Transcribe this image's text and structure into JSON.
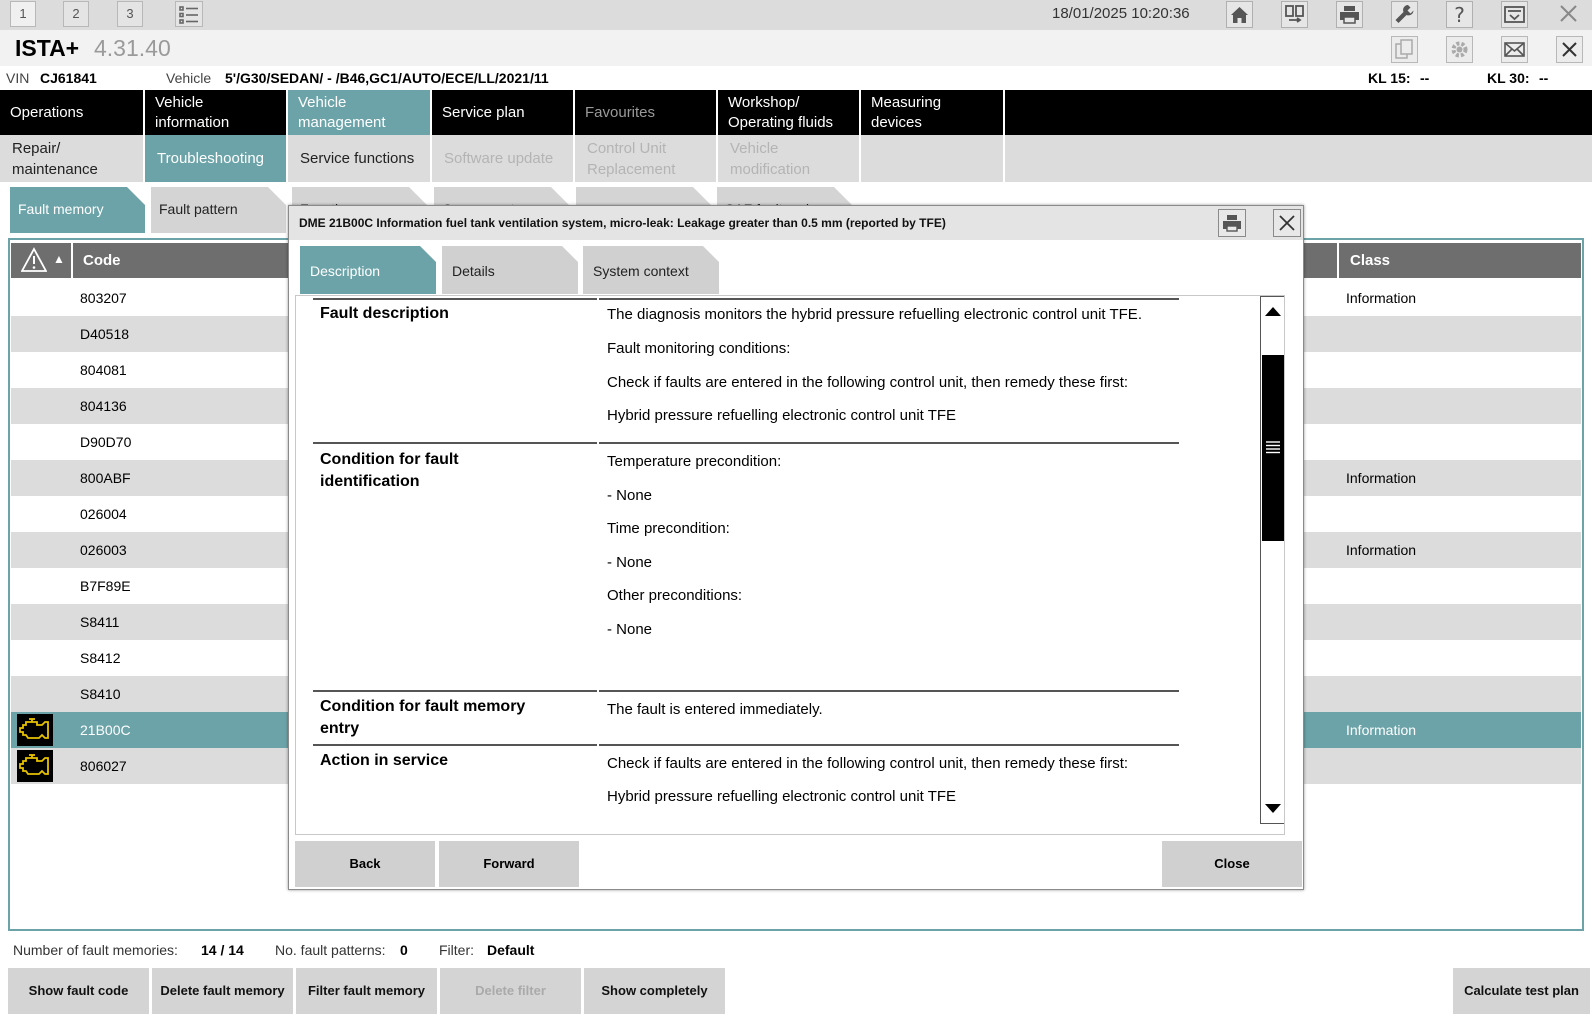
{
  "topbar": {
    "numbers": [
      "1",
      "2",
      "3"
    ],
    "datetime": "18/01/2025 10:20:36",
    "icons": [
      "list-icon",
      "home-icon",
      "transfer-icon",
      "printer-icon",
      "wrench-icon",
      "help-icon",
      "download-icon",
      "close-icon"
    ]
  },
  "app": {
    "title": "ISTA+",
    "version": "4.31.40"
  },
  "vehicle": {
    "vin_label": "VIN",
    "vin": "CJ61841",
    "vehicle_label": "Vehicle",
    "vehicle": "5'/G30/SEDAN/ - /B46,GC1/AUTO/ECE/LL/2021/11",
    "kl15_label": "KL 15:",
    "kl15": "--",
    "kl30_label": "KL 30:",
    "kl30": "--"
  },
  "mainnav": [
    "Operations",
    "Vehicle information",
    "Vehicle management",
    "Service plan",
    "Favourites",
    "Workshop/ Operating fluids",
    "Measuring devices"
  ],
  "subnav": [
    "Repair/ maintenance",
    "Troubleshooting",
    "Service functions",
    "Software update",
    "Control Unit Replacement",
    "Vehicle modification"
  ],
  "tabs": [
    "Fault memory",
    "Fault pattern",
    "Function",
    "Component",
    "",
    "SAF fault code"
  ],
  "table": {
    "headers": {
      "code": "Code",
      "class": "Class",
      "sort": "▲"
    },
    "rows": [
      {
        "code": "803207",
        "class": "Information"
      },
      {
        "code": "D40518",
        "class": ""
      },
      {
        "code": "804081",
        "class": ""
      },
      {
        "code": "804136",
        "class": ""
      },
      {
        "code": "D90D70",
        "class": ""
      },
      {
        "code": "800ABF",
        "class": "Information"
      },
      {
        "code": "026004",
        "class": ""
      },
      {
        "code": "026003",
        "class": "Information"
      },
      {
        "code": "B7F89E",
        "class": ""
      },
      {
        "code": "S8411",
        "class": ""
      },
      {
        "code": "S8412",
        "class": ""
      },
      {
        "code": "S8410",
        "class": ""
      },
      {
        "code": "21B00C",
        "class": "Information"
      },
      {
        "code": "806027",
        "class": ""
      }
    ]
  },
  "status": {
    "fault_memories_label": "Number of fault memories:",
    "fault_memories": "14 / 14",
    "fault_patterns_label": "No. fault patterns:",
    "fault_patterns": "0",
    "filter_label": "Filter:",
    "filter": "Default"
  },
  "buttons": {
    "show_fault_code": "Show fault code",
    "delete_fault_memory": "Delete fault memory",
    "filter_fault_memory": "Filter fault memory",
    "delete_filter": "Delete filter",
    "show_completely": "Show completely",
    "calculate_test_plan": "Calculate test plan"
  },
  "modal": {
    "title": "DME 21B00C Information fuel tank ventilation system, micro-leak: Leakage greater than 0.5 mm (reported by TFE)",
    "tabs": [
      "Description",
      "Details",
      "System context"
    ],
    "sections": {
      "fault_description": {
        "label": "Fault description",
        "lines": [
          "The diagnosis monitors the hybrid pressure refuelling electronic control unit TFE.",
          "Fault monitoring conditions:",
          "Check if faults are entered in the following control unit, then remedy these first:",
          "Hybrid pressure refuelling electronic control unit TFE"
        ]
      },
      "condition_identification": {
        "label": "Condition for fault identification",
        "lines": [
          "Temperature precondition:",
          "- None",
          "Time precondition:",
          "- None",
          "Other preconditions:",
          "- None"
        ]
      },
      "condition_entry": {
        "label": "Condition for fault memory entry",
        "lines": [
          "The fault is entered immediately."
        ]
      },
      "action_service": {
        "label": "Action in service",
        "lines": [
          "Check if faults are entered in the following control unit, then remedy these first:",
          "Hybrid pressure refuelling electronic control unit TFE"
        ]
      }
    },
    "footer": {
      "back": "Back",
      "forward": "Forward",
      "close": "Close"
    }
  }
}
